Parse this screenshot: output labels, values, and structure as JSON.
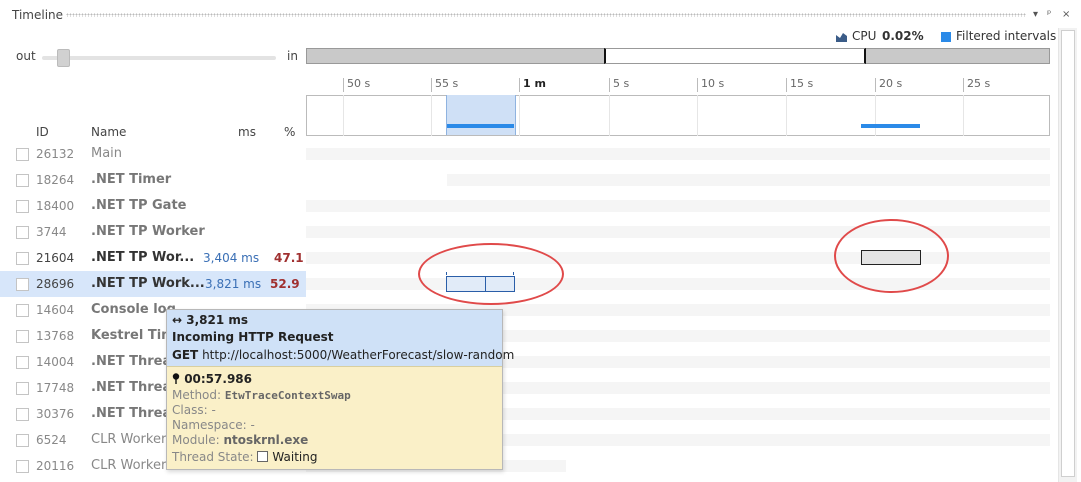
{
  "window": {
    "title": "Timeline",
    "controls": [
      "▾",
      "ᵖ",
      "×"
    ]
  },
  "legend": {
    "cpu_label": "CPU",
    "cpu_value": "0.02%",
    "filtered_label": "Filtered intervals",
    "cpu_icon": "cpu-chart-icon",
    "filtered_color": "#2b8ae8"
  },
  "zoom": {
    "out_label": "out",
    "in_label": "in",
    "level": 0.08
  },
  "ruler": {
    "labels": [
      "50 s",
      "55 s",
      "1 m",
      "5 s",
      "10 s",
      "15 s",
      "20 s",
      "25 s"
    ]
  },
  "threads": {
    "headers": {
      "id": "ID",
      "name": "Name",
      "ms": "ms",
      "pct": "%"
    },
    "rows": [
      {
        "id": "26132",
        "name": "Main",
        "ms": "",
        "pct": ""
      },
      {
        "id": "18264",
        "name": ".NET Timer",
        "ms": "",
        "pct": ""
      },
      {
        "id": "18400",
        "name": ".NET TP Gate",
        "ms": "",
        "pct": ""
      },
      {
        "id": "3744",
        "name": ".NET TP Worker",
        "ms": "",
        "pct": ""
      },
      {
        "id": "21604",
        "name": ".NET TP Wor...",
        "ms": "3,404 ms",
        "pct": "47.1"
      },
      {
        "id": "28696",
        "name": ".NET TP Work...",
        "ms": "3,821 ms",
        "pct": "52.9"
      },
      {
        "id": "14604",
        "name": "Console log",
        "ms": "",
        "pct": ""
      },
      {
        "id": "13768",
        "name": "Kestrel Tim",
        "ms": "",
        "pct": ""
      },
      {
        "id": "14004",
        "name": ".NET Threa",
        "ms": "",
        "pct": ""
      },
      {
        "id": "17748",
        "name": ".NET Threa",
        "ms": "",
        "pct": ""
      },
      {
        "id": "30376",
        "name": ".NET Threa",
        "ms": "",
        "pct": ""
      },
      {
        "id": "6524",
        "name": "CLR Worker",
        "ms": "",
        "pct": ""
      },
      {
        "id": "20116",
        "name": "CLR Worker",
        "ms": "",
        "pct": ""
      }
    ]
  },
  "tooltip": {
    "duration_icon": "↔",
    "duration": "3,821 ms",
    "title": "Incoming HTTP Request",
    "method_verb": "GET",
    "url": "http://localhost:5000/WeatherForecast/slow-random",
    "pin_icon": "pin-icon",
    "time": "00:57.986",
    "method_key": "Method:",
    "method_value": "EtwTraceContextSwap",
    "class_key": "Class:",
    "class_value": "-",
    "namespace_key": "Namespace:",
    "namespace_value": "-",
    "module_key": "Module:",
    "module_value": "ntoskrnl.exe",
    "thread_state_key": "Thread State:",
    "thread_state_value": "Waiting"
  },
  "colors": {
    "accent_blue": "#2b8ae8",
    "selection": "#d7e6fa",
    "annotation_red": "#e04a4a"
  }
}
